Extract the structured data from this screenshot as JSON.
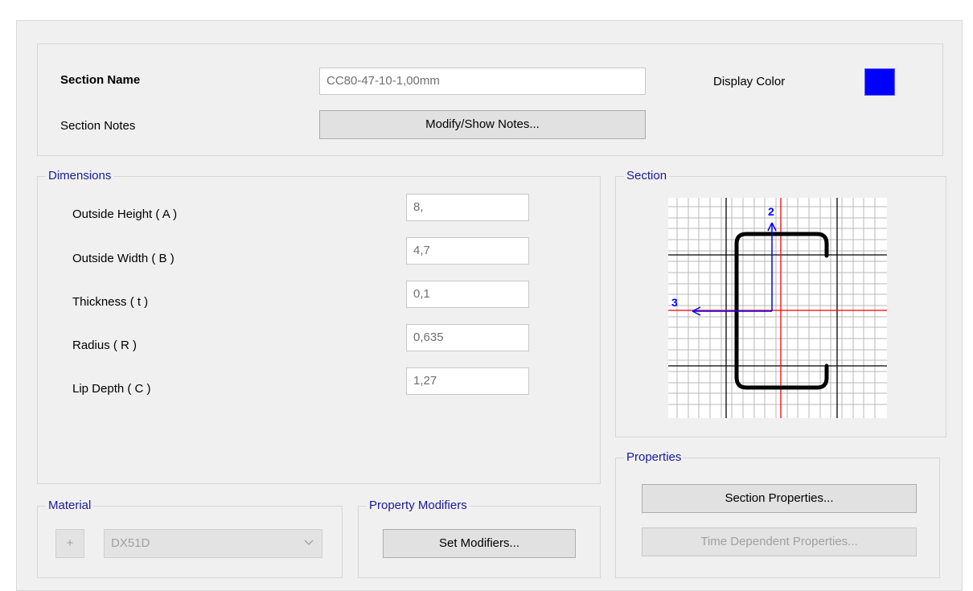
{
  "section": {
    "name_label": "Section Name",
    "name_value": "CC80-47-10-1,00mm",
    "display_color_label": "Display Color",
    "display_color": "#0000ff",
    "notes_label": "Section Notes",
    "notes_button": "Modify/Show Notes..."
  },
  "dimensions": {
    "title": "Dimensions",
    "fields": [
      {
        "label": "Outside Height  ( A )",
        "value": "8,"
      },
      {
        "label": "Outside Width  ( B )",
        "value": "4,7"
      },
      {
        "label": "Thickness  ( t )",
        "value": "0,1"
      },
      {
        "label": "Radius  ( R )",
        "value": "0,635"
      },
      {
        "label": "Lip Depth  ( C )",
        "value": "1,27"
      }
    ]
  },
  "preview": {
    "title": "Section",
    "axis_2_label": "2",
    "axis_3_label": "3"
  },
  "properties": {
    "title": "Properties",
    "section_properties_button": "Section Properties...",
    "time_dependent_button": "Time Dependent Properties..."
  },
  "material": {
    "title": "Material",
    "add_button": "+",
    "selected": "DX51D"
  },
  "modifiers": {
    "title": "Property Modifiers",
    "set_button": "Set Modifiers..."
  }
}
